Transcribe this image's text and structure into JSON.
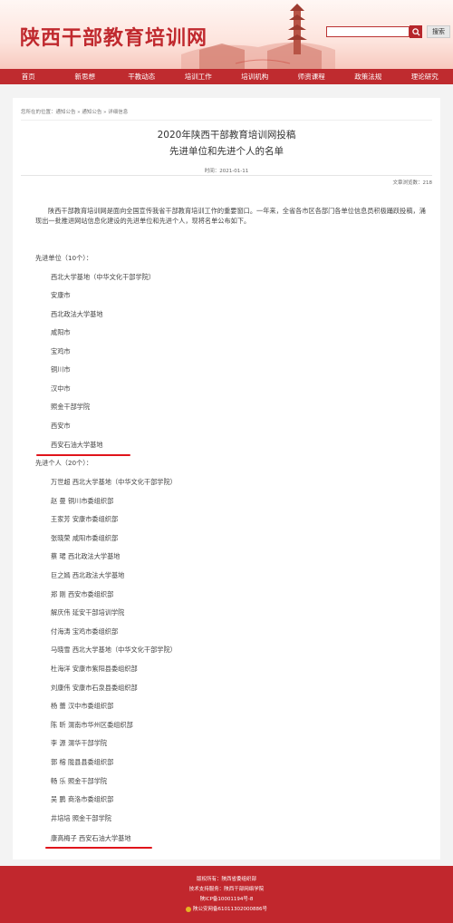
{
  "header": {
    "site_title": "陕西干部教育培训网",
    "search_placeholder": "",
    "search_button_label": "搜索"
  },
  "nav": {
    "items": [
      "首页",
      "新思想",
      "干教动态",
      "培训工作",
      "培训机构",
      "师资课程",
      "政策法规",
      "理论研究"
    ]
  },
  "breadcrumb": "您所在的位置：通知公告 » 通知公告 » 详细信息",
  "article": {
    "title_line1": "2020年陕西干部教育培训网投稿",
    "title_line2": "先进单位和先进个人的名单",
    "time": "时间：2021-01-11",
    "views": "文章浏览数：218",
    "intro": "陕西干部教育培训网是面向全国宣传我省干部教育培训工作的重要窗口。一年来，全省各市区各部门各单位信息员积极踊跃投稿，涌现出一批推进网站信息化建设的先进单位和先进个人，现将名单公布如下。",
    "units_heading": "先进单位（10个）：",
    "units": [
      "西北大学基地（中华文化干部学院）",
      "安康市",
      "西北政法大学基地",
      "咸阳市",
      "宝鸡市",
      "铜川市",
      "汉中市",
      "照金干部学院",
      "西安市",
      "西安石油大学基地"
    ],
    "people_heading": "先进个人（20个）：",
    "people": [
      "万世超 西北大学基地（中华文化干部学院）",
      "赵 曼 铜川市委组织部",
      "王家芳 安康市委组织部",
      "张晓荣 咸阳市委组织部",
      "蔡 珺 西北政法大学基地",
      "巨之嫣 西北政法大学基地",
      "郑 刚 西安市委组织部",
      "解庆伟 延安干部培训学院",
      "付海涛 宝鸡市委组织部",
      "马晓雪 西北大学基地（中华文化干部学院）",
      "杜海洋 安康市紫阳县委组织部",
      "刘康伟 安康市石泉县委组织部",
      "杨 蕾 汉中市委组织部",
      "陈 昕 渭南市华州区委组织部",
      "李 源 渭华干部学院",
      "郭 榕 陇县县委组织部",
      "畅 乐 照金干部学院",
      "吴 鹏 商洛市委组织部",
      "井培培 照金干部学院",
      "康高梅子 西安石油大学基地"
    ]
  },
  "footer": {
    "line1": "版权所有：陕西省委组织部",
    "line2": "技术支持服务：陕西干部网络学院",
    "line3": "陕ICP备10001194号-8",
    "line4": "陕公安网备61011302000886号"
  },
  "colors": {
    "brand_red": "#bf2b2f",
    "underline_red": "#e0141b"
  }
}
